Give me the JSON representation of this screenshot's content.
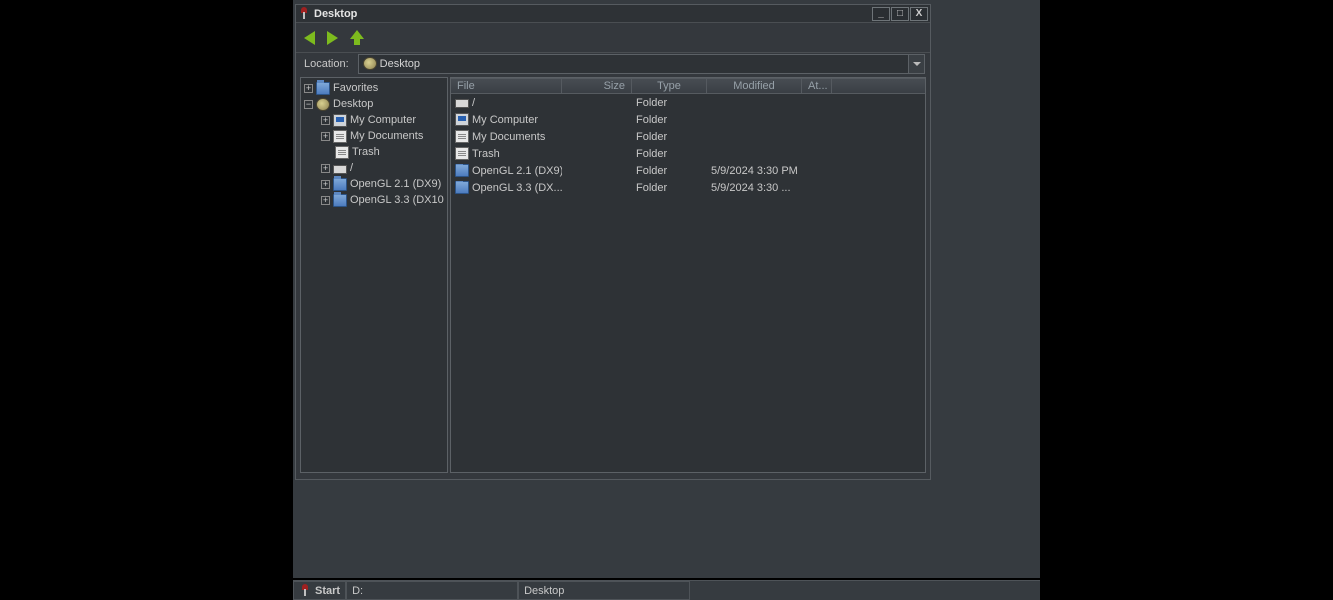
{
  "window": {
    "title": "Desktop",
    "location_label": "Location:",
    "location_value": "Desktop"
  },
  "columns": {
    "file": "File",
    "size": "Size",
    "type": "Type",
    "modified": "Modified",
    "attr": "At..."
  },
  "tree": {
    "favorites": "Favorites",
    "desktop": "Desktop",
    "my_computer": "My Computer",
    "my_documents": "My Documents",
    "trash": "Trash",
    "root": "/",
    "opengl21": "OpenGL 2.1 (DX9)",
    "opengl33": "OpenGL 3.3 (DX10"
  },
  "files": [
    {
      "name": "/",
      "icon": "drive",
      "type": "Folder",
      "modified": ""
    },
    {
      "name": "My Computer",
      "icon": "computer",
      "type": "Folder",
      "modified": ""
    },
    {
      "name": "My Documents",
      "icon": "doc",
      "type": "Folder",
      "modified": ""
    },
    {
      "name": "Trash",
      "icon": "doc",
      "type": "Folder",
      "modified": ""
    },
    {
      "name": "OpenGL 2.1 (DX9)",
      "icon": "folder",
      "type": "Folder",
      "modified": "5/9/2024 3:30 PM"
    },
    {
      "name": "OpenGL 3.3 (DX...",
      "icon": "folder",
      "type": "Folder",
      "modified": "5/9/2024 3:30 ..."
    }
  ],
  "taskbar": {
    "start": "Start",
    "d": "D:",
    "desktop": "Desktop"
  },
  "col_widths": {
    "file": 111,
    "size": 70,
    "type": 75,
    "modified": 95,
    "attr": 30
  }
}
